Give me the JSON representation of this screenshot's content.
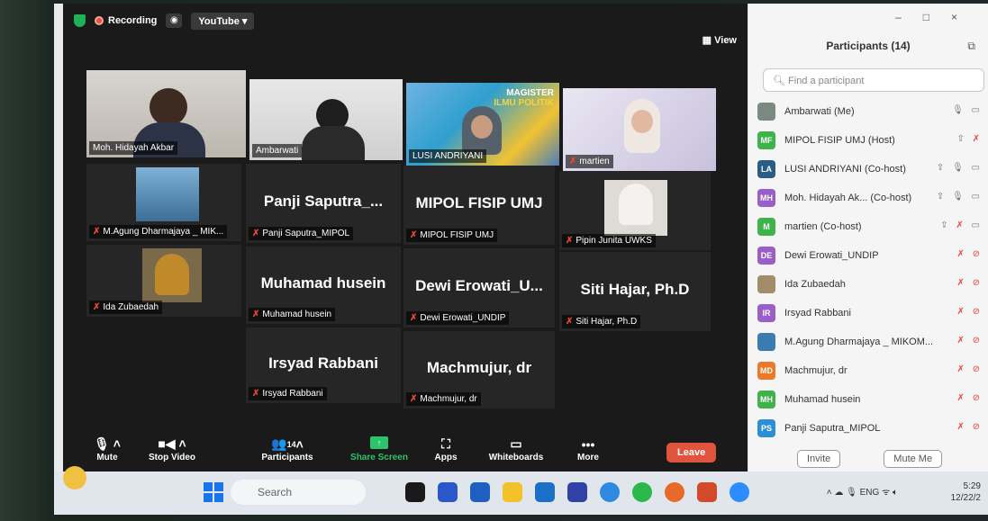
{
  "topbar": {
    "recording": "Recording",
    "stream": "YouTube ▾",
    "view": "View"
  },
  "tiles": [
    {
      "name": "Moh. Hidayah Akbar",
      "big": "",
      "muted": false
    },
    {
      "name": "Ambarwati",
      "big": "",
      "muted": false
    },
    {
      "name": "LUSI ANDRIYANI",
      "big": "",
      "muted": false
    },
    {
      "name": "martien",
      "big": "",
      "muted": true
    },
    {
      "name": "M.Agung Dharmajaya _ MIK...",
      "big": "",
      "muted": true
    },
    {
      "name": "Panji Saputra_MIPOL",
      "big": "Panji Saputra_...",
      "muted": true
    },
    {
      "name": "MIPOL FISIP UMJ",
      "big": "MIPOL FISIP UMJ",
      "muted": true
    },
    {
      "name": "Pipin Junita UWKS",
      "big": "",
      "muted": true
    },
    {
      "name": "Ida Zubaedah",
      "big": "",
      "muted": true
    },
    {
      "name": "Muhamad husein",
      "big": "Muhamad husein",
      "muted": true
    },
    {
      "name": "Dewi Erowati_UNDIP",
      "big": "Dewi Erowati_U...",
      "muted": true
    },
    {
      "name": "Siti Hajar, Ph.D",
      "big": "Siti Hajar, Ph.D",
      "muted": true
    },
    {
      "name": "Irsyad Rabbani",
      "big": "Irsyad Rabbani",
      "muted": true
    },
    {
      "name": "Machmujur, dr",
      "big": "Machmujur, dr",
      "muted": true
    }
  ],
  "banner": {
    "line1": "MAGISTER",
    "line2": "ILMU POLITIK"
  },
  "controls": {
    "mute": "Mute",
    "stop_video": "Stop Video",
    "participants": "Participants",
    "count": "14",
    "share": "Share Screen",
    "apps": "Apps",
    "whiteboards": "Whiteboards",
    "more": "More",
    "leave": "Leave"
  },
  "panel": {
    "title": "Participants (14)",
    "search_placeholder": "Find a participant",
    "invite": "Invite",
    "mute_me": "Mute Me"
  },
  "participants": [
    {
      "initials": "",
      "name": "Ambarwati (Me)",
      "color": "#7a8a80"
    },
    {
      "initials": "MF",
      "name": "MIPOL FISIP UMJ (Host)",
      "color": "#3fb24a"
    },
    {
      "initials": "LA",
      "name": "LUSI ANDRIYANI (Co-host)",
      "color": "#2b5d84"
    },
    {
      "initials": "MH",
      "name": "Moh. Hidayah Ak... (Co-host)",
      "color": "#9a5fc7"
    },
    {
      "initials": "M",
      "name": "martien (Co-host)",
      "color": "#3fb24a"
    },
    {
      "initials": "DE",
      "name": "Dewi Erowati_UNDIP",
      "color": "#9a5fc7"
    },
    {
      "initials": "",
      "name": "Ida Zubaedah",
      "color": "#a38c6a"
    },
    {
      "initials": "IR",
      "name": "Irsyad Rabbani",
      "color": "#9a5fc7"
    },
    {
      "initials": "",
      "name": "M.Agung Dharmajaya _ MIKOM...",
      "color": "#3a7bb0"
    },
    {
      "initials": "MD",
      "name": "Machmujur, dr",
      "color": "#e97a2a"
    },
    {
      "initials": "MH",
      "name": "Muhamad husein",
      "color": "#3fb24a"
    },
    {
      "initials": "PS",
      "name": "Panji Saputra_MIPOL",
      "color": "#2f8fd4"
    }
  ],
  "taskbar": {
    "search": "Search",
    "lang": "ENG",
    "time": "5:29",
    "date": "12/22/2"
  }
}
